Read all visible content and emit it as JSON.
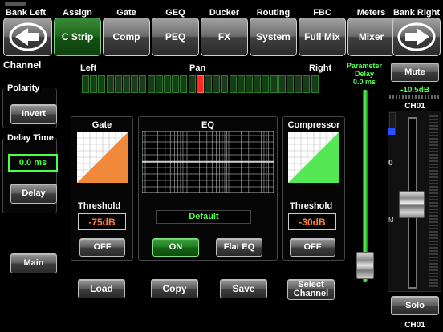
{
  "nav": {
    "bank_left": "Bank Left",
    "bank_right": "Bank Right",
    "tabs": [
      {
        "top": "Assign",
        "label": "C Strip"
      },
      {
        "top": "Gate",
        "label": "Comp"
      },
      {
        "top": "GEQ",
        "label": "PEQ"
      },
      {
        "top": "Ducker",
        "label": "FX"
      },
      {
        "top": "Routing",
        "label": "System"
      },
      {
        "top": "FBC",
        "label": "Full Mix"
      },
      {
        "top": "Meters",
        "label": "Mixer"
      }
    ]
  },
  "channel": {
    "title": "Channel",
    "polarity_label": "Polarity",
    "invert_label": "Invert",
    "delay_time_label": "Delay Time",
    "delay_value": "0.0 ms",
    "delay_button": "Delay",
    "main_button": "Main"
  },
  "pan": {
    "left": "Left",
    "center": "Pan",
    "right": "Right",
    "segments": 29,
    "active_segment": 14
  },
  "gate": {
    "title": "Gate",
    "threshold_label": "Threshold",
    "threshold_value": "-75dB",
    "toggle_label": "OFF",
    "color": "#f0893a"
  },
  "eq": {
    "title": "EQ",
    "preset": "Default",
    "on_label": "ON",
    "flat_label": "Flat EQ"
  },
  "compressor": {
    "title": "Compressor",
    "threshold_label": "Threshold",
    "threshold_value": "-30dB",
    "toggle_label": "OFF",
    "color": "#55e855"
  },
  "actions": {
    "load": "Load",
    "copy": "Copy",
    "save": "Save",
    "select_channel": "Select Channel"
  },
  "parameter": {
    "label_line1": "Parameter",
    "label_line2": "Delay",
    "value": "0.0 ms",
    "level": 0.02
  },
  "fader": {
    "mute": "Mute",
    "level_db": "-10.5dB",
    "channel_name": "CH01",
    "scale_zero": "0",
    "scale_m": "M",
    "solo": "Solo",
    "bottom_name": "CH01",
    "accent": "#55ff55"
  }
}
